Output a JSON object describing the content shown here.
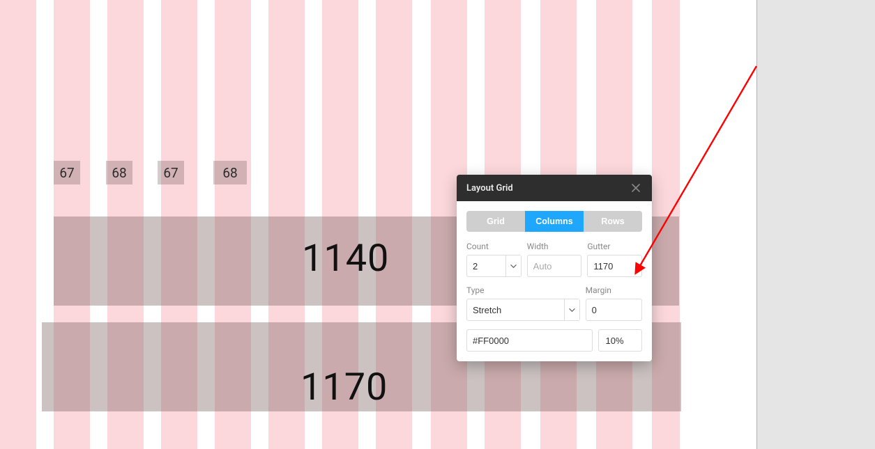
{
  "canvas": {
    "small_tags": [
      "67",
      "68",
      "67",
      "68"
    ],
    "block_1140": "1140",
    "block_1170": "1170"
  },
  "panel": {
    "title": "Layout Grid",
    "tabs": {
      "grid": "Grid",
      "columns": "Columns",
      "rows": "Rows"
    },
    "labels": {
      "count": "Count",
      "width": "Width",
      "gutter": "Gutter",
      "type": "Type",
      "margin": "Margin"
    },
    "values": {
      "count": "2",
      "width_placeholder": "Auto",
      "gutter": "1170",
      "type": "Stretch",
      "margin": "0",
      "color": "#FF0000",
      "opacity": "10%"
    }
  }
}
